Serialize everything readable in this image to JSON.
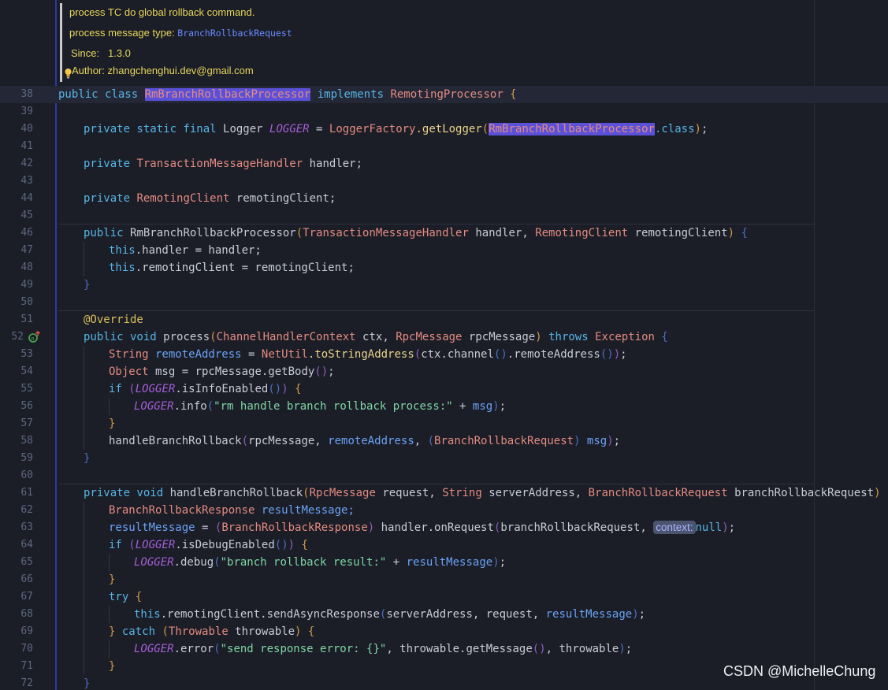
{
  "doc": {
    "line1": "process TC do global rollback command.",
    "line2_text": "process message type: ",
    "line2_code": "BranchRollbackRequest",
    "since_label": "Since:",
    "since_value": "1.3.0",
    "author_label": "Author:",
    "author_value": "zhangchenghui.dev@gmail.com"
  },
  "lines": [
    {
      "n": "38"
    },
    {
      "n": "39"
    },
    {
      "n": "40"
    },
    {
      "n": "41"
    },
    {
      "n": "42"
    },
    {
      "n": "43"
    },
    {
      "n": "44"
    },
    {
      "n": "45"
    },
    {
      "n": "46"
    },
    {
      "n": "47"
    },
    {
      "n": "48"
    },
    {
      "n": "49"
    },
    {
      "n": "50"
    },
    {
      "n": "51"
    },
    {
      "n": "52"
    },
    {
      "n": "53"
    },
    {
      "n": "54"
    },
    {
      "n": "55"
    },
    {
      "n": "56"
    },
    {
      "n": "57"
    },
    {
      "n": "58"
    },
    {
      "n": "59"
    },
    {
      "n": "60"
    },
    {
      "n": "61"
    },
    {
      "n": "62"
    },
    {
      "n": "63"
    },
    {
      "n": "64"
    },
    {
      "n": "65"
    },
    {
      "n": "66"
    },
    {
      "n": "67"
    },
    {
      "n": "68"
    },
    {
      "n": "69"
    },
    {
      "n": "70"
    },
    {
      "n": "71"
    },
    {
      "n": "72"
    }
  ],
  "code": {
    "public_class": "public class ",
    "class_name": "RmBranchRollbackProcessor",
    "implements": " implements ",
    "iface": "RemotingProcessor",
    "lbrace": " {",
    "private_static_final": "private static final ",
    "logger_type": "Logger",
    "logger_const": "LOGGER",
    "assign": " = ",
    "logger_factory": "LoggerFactory",
    "get_logger": ".getLogger",
    "lparen": "(",
    "rparen": ")",
    "dot_class": ".class",
    "semicolon": ";",
    "private": "private ",
    "tmh_type": "TransactionMessageHandler",
    "handler_field": " handler;",
    "rc_type": "RemotingClient",
    "rc_field": " remotingClient;",
    "public": "public ",
    "ctor_name": "RmBranchRollbackProcessor",
    "handler_param": " handler, ",
    "rc_param": " remotingClient",
    "this": "this",
    "this_handler": ".handler = handler;",
    "this_rc": ".remotingClient = remotingClient;",
    "rbrace": "}",
    "override": "@Override",
    "public_void": "public void ",
    "process": "process",
    "chc_type": "ChannelHandlerContext",
    "ctx_param": " ctx, ",
    "rpcmsg_type": "RpcMessage",
    "rpcmsg_param": " rpcMessage",
    "throws": " throws ",
    "exception": "Exception",
    "string_type": "String",
    "remote_address": " remoteAddress",
    "netutil": "NetUtil",
    "to_string_address": ".toStringAddress",
    "ctx_channel": "ctx.channel",
    "remote_address_call": ".remoteAddress",
    "object_type": "Object",
    "msg_assign": " msg = rpcMessage.getBody",
    "msg_var": " msg",
    "if_kw": "if ",
    "is_info_enabled": ".isInfoEnabled",
    "info": ".info",
    "str_rm_handle": "\"rm handle branch rollback process:\"",
    "plus": " + ",
    "msg": "msg",
    "handle_branch_rollback": "handleBranchRollback",
    "rpc_message_arg": "rpcMessage, ",
    "remote_address_arg": "remoteAddress",
    "comma": ", ",
    "brr_type": "BranchRollbackRequest",
    "private_void": "private void ",
    "request_param": " request, ",
    "server_address_param": " serverAddress, ",
    "brr_param": " branchRollbackRequest",
    "brresp_type": "BranchRollbackResponse",
    "result_message": "resultMessage",
    "result_message_decl": " resultMessage;",
    "handler_on_request": " handler.onRequest",
    "brr_arg": "branchRollbackRequest, ",
    "hint_context": "context:",
    "null": "null",
    "is_debug_enabled": ".isDebugEnabled",
    "debug": ".debug",
    "str_branch_result": "\"branch rollback result:\"",
    "try": "try",
    "send_async_response": ".remotingClient.sendAsyncResponse",
    "server_address_arg": "serverAddress, request, ",
    "catch": " catch ",
    "throwable_type": "Throwable",
    "throwable_param": " throwable",
    "error": ".error",
    "str_send_error": "\"send response error: {}\"",
    "throwable_get_message": "throwable.getMessage",
    "throwable_arg": "throwable"
  },
  "watermark": "CSDN @MichelleChung"
}
